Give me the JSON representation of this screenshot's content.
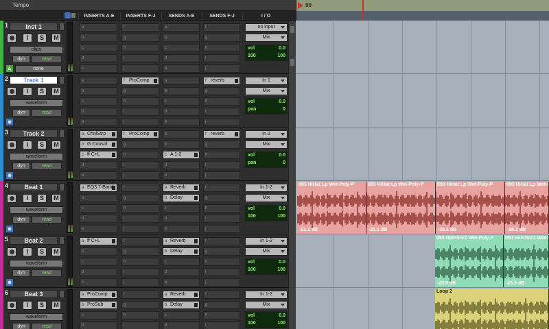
{
  "header": {
    "tempo_label": "Tempo",
    "ruler_mark": "90"
  },
  "columns": {
    "inserts_ae": "INSERTS A-E",
    "inserts_fj": "INSERTS F-J",
    "sends_ae": "SENDS A-E",
    "sends_fj": "SENDS F-J",
    "io": "I / O"
  },
  "record_buttons": {
    "input": "I",
    "solo": "S",
    "mute": "M"
  },
  "tracks": [
    {
      "num": "1",
      "name": "Inst 1",
      "color": "#3bb54a",
      "view": "clips",
      "dyn": "dyn",
      "auto": "read",
      "group": "none",
      "inserts_ae": [],
      "inserts_fj": [],
      "sends_ae": [],
      "sends_fj": [],
      "input": "no input",
      "output": "Mix",
      "vol_label": "vol",
      "vol": "0.0",
      "pan_l": "100",
      "pan_r": "100"
    },
    {
      "num": "2",
      "name": "Track 1",
      "color": "#2a8fd2",
      "view": "waveform",
      "dyn": "dyn",
      "auto": "read",
      "group": "",
      "inserts_ae": [],
      "inserts_fj": [
        "ProComp"
      ],
      "sends_ae": [],
      "sends_fj": [
        "reverb"
      ],
      "input": "In 1",
      "output": "Mix",
      "vol_label": "vol",
      "vol": "0.0",
      "pan_label": "pan",
      "pan": "0"
    },
    {
      "num": "3",
      "name": "Track 2",
      "color": "#2a8fd2",
      "view": "waveform",
      "dyn": "dyn",
      "auto": "read",
      "group": "",
      "inserts_ae": [
        "ChnlStrp",
        "G Consol",
        "ff C+L"
      ],
      "inserts_fj": [
        "ProComp"
      ],
      "sends_ae": [
        "A 1-2"
      ],
      "sends_fj": [
        "reverb"
      ],
      "input": "In 2",
      "output": "Mix",
      "vol_label": "vol",
      "vol": "0.0",
      "pan_label": "pan",
      "pan": "0"
    },
    {
      "num": "4",
      "name": "Beat 1",
      "color": "#c62d9a",
      "view": "waveform",
      "dyn": "dyn",
      "auto": "read",
      "group": "",
      "inserts_ae": [
        "EQ3 7-Band"
      ],
      "inserts_fj": [],
      "sends_ae": [
        "Reverb",
        "Delay"
      ],
      "sends_fj": [],
      "input": "In 1-2",
      "output": "Mix",
      "vol_label": "vol",
      "vol": "0.0",
      "pan_l": "100",
      "pan_r": "100"
    },
    {
      "num": "5",
      "name": "Beat 2",
      "color": "#c62d9a",
      "view": "waveform",
      "dyn": "dyn",
      "auto": "read",
      "group": "",
      "inserts_ae": [
        "ff C+L"
      ],
      "inserts_fj": [],
      "sends_ae": [
        "Reverb",
        "Delay"
      ],
      "sends_fj": [],
      "input": "In 1-2",
      "output": "Mix",
      "vol_label": "vol",
      "vol": "0.0",
      "pan_l": "100",
      "pan_r": "100"
    },
    {
      "num": "6",
      "name": "Beat 3",
      "color": "#c62d9a",
      "view": "waveform",
      "dyn": "dyn",
      "auto": "read",
      "group": "",
      "inserts_ae": [
        "ProComp",
        "ProSub"
      ],
      "inserts_fj": [],
      "sends_ae": [
        "Reverb",
        "Delay"
      ],
      "sends_fj": [],
      "input": "In 1-2",
      "output": "Mix",
      "vol_label": "vol",
      "vol": "0.0",
      "pan_l": "100",
      "pan_r": "100"
    }
  ],
  "slot_letters_ae": [
    "a",
    "b",
    "c",
    "d",
    "e"
  ],
  "slot_letters_fj": [
    "f",
    "g",
    "h",
    "i",
    "j"
  ],
  "clips": {
    "beat1": [
      {
        "name": "093 HiHat Lp Wet-Poly-P",
        "gain": "-21.1 dB"
      },
      {
        "name": "093 HiHat Lp Wet-Poly-P",
        "gain": "-21.1 dB"
      },
      {
        "name": "093 HiHat Lp Wet-Poly-P",
        "gain": "-26.1 dB"
      },
      {
        "name": "093 HiHat Lp Wet-Poly-P",
        "gain": "-26.1 dB"
      }
    ],
    "beat2": [
      {
        "name": "093 Hat+Snr1 Wet-Poly-F",
        "gain": "-23.5 dB"
      },
      {
        "name": "093 Hat+Snr1 Wet-Poly-F",
        "gain": "-23.5 dB"
      }
    ],
    "beat3": [
      {
        "name": "Loop 2",
        "gain": ""
      }
    ]
  },
  "colors": {
    "beat1_clip": "#e8a3a0",
    "beat1_wave": "#7a1a14",
    "beat2_clip": "#8fdcb6",
    "beat2_wave": "#1e4a30",
    "beat3_clip": "#dcd27a",
    "beat3_wave": "#4c4618"
  }
}
